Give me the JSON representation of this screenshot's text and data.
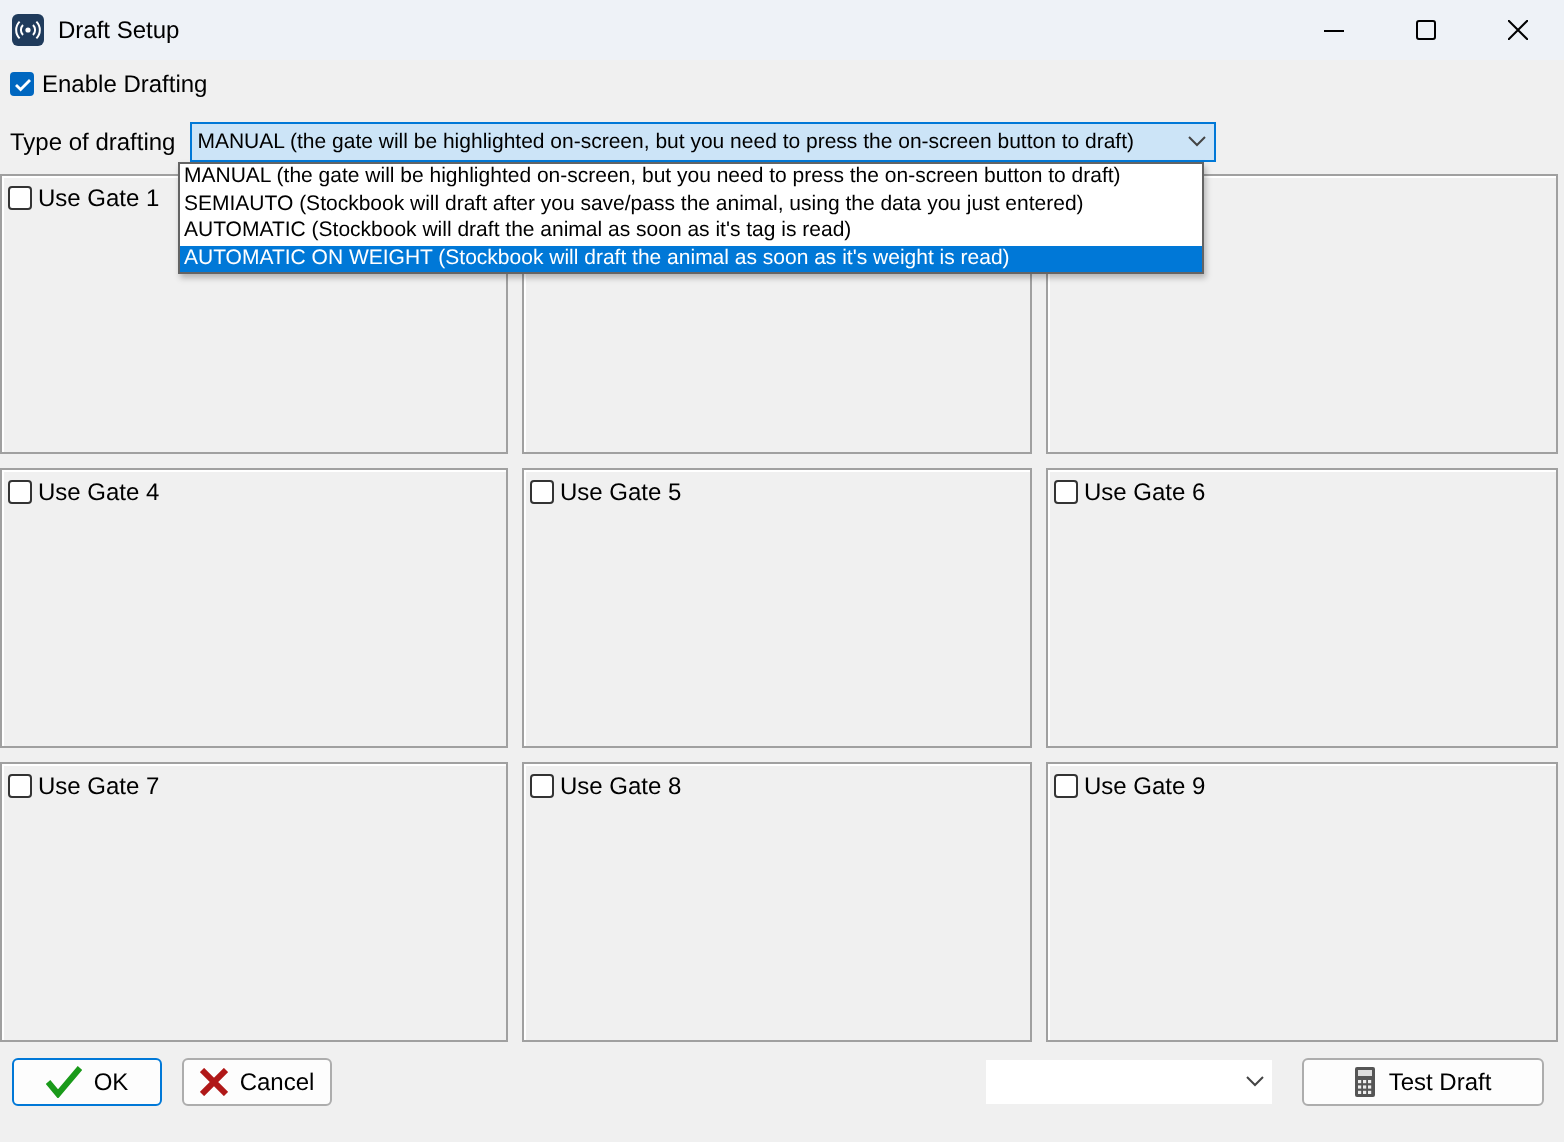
{
  "window": {
    "title": "Draft Setup"
  },
  "enable_drafting": {
    "label": "Enable Drafting",
    "checked": true
  },
  "type_of_drafting": {
    "label": "Type of drafting",
    "value": "MANUAL (the gate will be highlighted on-screen, but you need to press the on-screen button to draft)",
    "expanded": true,
    "options": [
      {
        "label": "MANUAL (the gate will be highlighted on-screen, but you need to press the on-screen button to draft)",
        "highlighted": false
      },
      {
        "label": "SEMIAUTO (Stockbook will draft after you save/pass the animal, using the data you just entered)",
        "highlighted": false
      },
      {
        "label": "AUTOMATIC (Stockbook will draft the animal as soon as it's tag is read)",
        "highlighted": false
      },
      {
        "label": "AUTOMATIC ON WEIGHT (Stockbook will draft the animal as soon as it's weight is read)",
        "highlighted": true
      }
    ]
  },
  "gate_rows": [
    [
      {
        "label": "Use Gate 1",
        "checked": false
      }
    ],
    [
      {
        "label": "Use Gate 4",
        "checked": false
      },
      {
        "label": "Use Gate 5",
        "checked": false
      },
      {
        "label": "Use Gate 6",
        "checked": false
      }
    ],
    [
      {
        "label": "Use Gate 7",
        "checked": false
      },
      {
        "label": "Use Gate 8",
        "checked": false
      },
      {
        "label": "Use Gate 9",
        "checked": false
      }
    ]
  ],
  "buttons": {
    "ok": "OK",
    "cancel": "Cancel",
    "test_draft": "Test Draft"
  }
}
